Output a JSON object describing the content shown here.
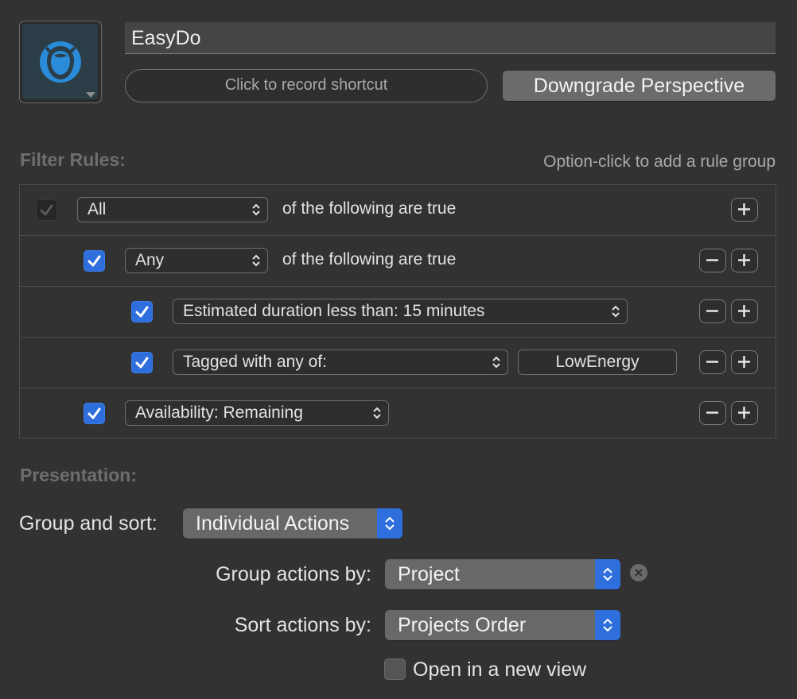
{
  "perspective": {
    "icon": "owl-app-icon",
    "name": "EasyDo",
    "shortcut_placeholder": "Click to record shortcut",
    "downgrade_label": "Downgrade Perspective"
  },
  "filter_rules": {
    "title": "Filter Rules:",
    "hint": "Option-click to add a rule group",
    "rows": [
      {
        "checked": true,
        "enabled": false,
        "popup": "All",
        "suffix": "of the following are true",
        "buttons": [
          "add"
        ]
      },
      {
        "checked": true,
        "enabled": true,
        "popup": "Any",
        "suffix": "of the following are true",
        "buttons": [
          "remove",
          "add"
        ]
      },
      {
        "checked": true,
        "enabled": true,
        "popup": "Estimated duration less than: 15 minutes",
        "buttons": [
          "remove",
          "add"
        ]
      },
      {
        "checked": true,
        "enabled": true,
        "popup": "Tagged with any of:",
        "token": "LowEnergy",
        "buttons": [
          "remove",
          "add"
        ]
      },
      {
        "checked": true,
        "enabled": true,
        "popup": "Availability: Remaining",
        "buttons": [
          "remove",
          "add"
        ]
      }
    ]
  },
  "presentation": {
    "title": "Presentation:",
    "group_sort_label": "Group and sort:",
    "group_sort_value": "Individual Actions",
    "group_by_label": "Group actions by:",
    "group_by_value": "Project",
    "sort_by_label": "Sort actions by:",
    "sort_by_value": "Projects Order",
    "open_new_view_label": "Open in a new view",
    "open_new_view_checked": false
  },
  "colors": {
    "background": "#323232",
    "accent": "#2f6fdd",
    "section_title": "#6e6e6e"
  }
}
